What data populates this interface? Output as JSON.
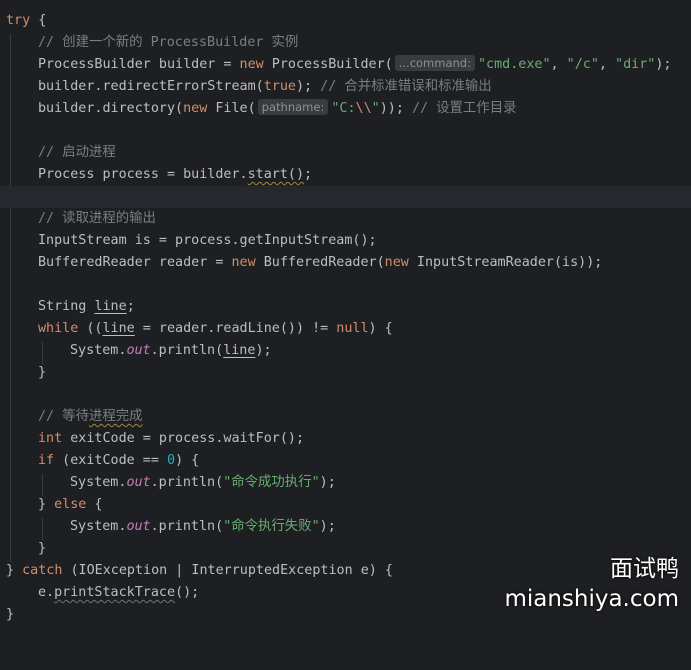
{
  "editor": {
    "lines": {
      "l1": {
        "kw_try": "try",
        "brace": " {"
      },
      "l2": {
        "comment": "// 创建一个新的 ProcessBuilder 实例"
      },
      "l3": {
        "a": "ProcessBuilder builder = ",
        "kw_new": "new",
        "b": " ProcessBuilder(",
        "hint": "...command:",
        "s1": "\"cmd.exe\"",
        "c1": ", ",
        "s2": "\"/c\"",
        "c2": ", ",
        "s3": "\"dir\"",
        "end": ");"
      },
      "l4": {
        "a": "builder.redirectErrorStream(",
        "kw_true": "true",
        "b": "); ",
        "comment": "// 合并标准错误和标准输出"
      },
      "l5": {
        "a": "builder.directory(",
        "kw_new": "new",
        "b": " File(",
        "hint": "pathname:",
        "s_open": "\"C:",
        "s_esc": "\\\\",
        "s_close": "\"",
        "c": ")); ",
        "comment": "// 设置工作目录"
      },
      "l7": {
        "comment": "// 启动进程"
      },
      "l8": {
        "a": "Process process = builder.",
        "method": "start()",
        "end": ";"
      },
      "l10": {
        "comment": "// 读取进程的输出"
      },
      "l11": {
        "text": "InputStream is = process.getInputStream();"
      },
      "l12": {
        "a": "BufferedReader reader = ",
        "kw_new1": "new",
        "b": " BufferedReader(",
        "kw_new2": "new",
        "c": " InputStreamReader(is));"
      },
      "l14": {
        "a": "String ",
        "var": "line",
        "end": ";"
      },
      "l15": {
        "kw_while": "while",
        "a": " ((",
        "var": "line",
        "b": " = reader.readLine()) != ",
        "kw_null": "null",
        "c": ") {"
      },
      "l16": {
        "a": "System.",
        "fld": "out",
        "b": ".println(",
        "var": "line",
        "c": ");"
      },
      "l17": {
        "text": "}"
      },
      "l19": {
        "comment_a": "// 等待",
        "comment_b": "进程完成"
      },
      "l20": {
        "kw_int": "int",
        "a": " exitCode = process.waitFor();"
      },
      "l21": {
        "kw_if": "if",
        "a": " (exitCode == ",
        "num": "0",
        "b": ") {"
      },
      "l22": {
        "a": "System.",
        "fld": "out",
        "b": ".println(",
        "str": "\"命令成功执行\"",
        "c": ");"
      },
      "l23": {
        "a": "} ",
        "kw_else": "else",
        "b": " {"
      },
      "l24": {
        "a": "System.",
        "fld": "out",
        "b": ".println(",
        "str": "\"命令执行失败\"",
        "c": ");"
      },
      "l25": {
        "text": "}"
      },
      "l26": {
        "a": "} ",
        "kw_catch": "catch",
        "b": " (IOException | InterruptedException e) {"
      },
      "l27": {
        "a": "e.",
        "method": "printStackTrace",
        "b": "();"
      },
      "l28": {
        "text": "}"
      }
    }
  },
  "watermark": {
    "cn": "面试鸭",
    "en": "mianshiya.com"
  },
  "colors": {
    "background": "#1e1f22",
    "keyword": "#cf8e6d",
    "string": "#6aab73",
    "comment": "#7a7e85",
    "number": "#2aacb8",
    "field": "#c77dbb",
    "text": "#bcbec4"
  }
}
